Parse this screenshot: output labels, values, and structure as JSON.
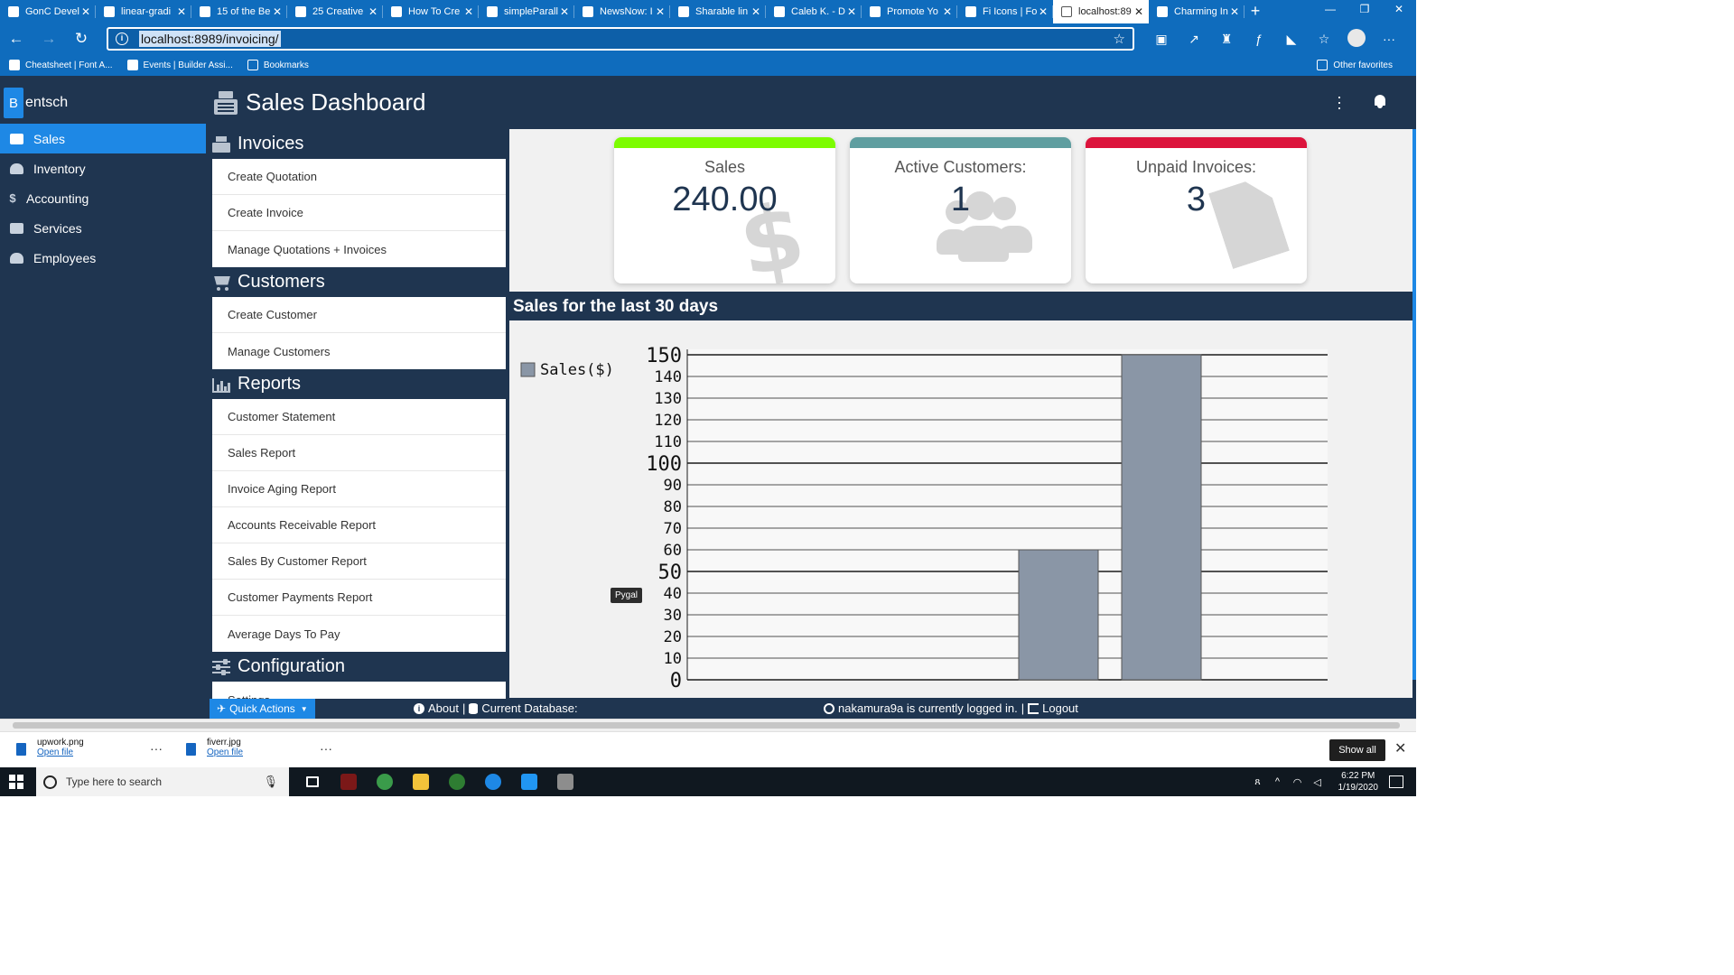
{
  "browser": {
    "tabs": [
      {
        "title": "GonC Devel",
        "icon": "page-icon",
        "active": false
      },
      {
        "title": "linear-gradi",
        "icon": "github-icon",
        "active": false
      },
      {
        "title": "15 of the Be",
        "icon": "site-icon",
        "active": false
      },
      {
        "title": "25 Creative",
        "icon": "se-icon",
        "active": false
      },
      {
        "title": "How To Cre",
        "icon": "site-icon",
        "active": false
      },
      {
        "title": "simpleParall",
        "icon": "site-icon",
        "active": false
      },
      {
        "title": "NewsNow: I",
        "icon": "news-icon",
        "active": false
      },
      {
        "title": "Sharable lin",
        "icon": "fiverr-icon",
        "active": false
      },
      {
        "title": "Caleb K. - D",
        "icon": "upwork-icon",
        "active": false
      },
      {
        "title": "Promote Yo",
        "icon": "fiverr-icon",
        "active": false
      },
      {
        "title": "Fi Icons | Fo",
        "icon": "flag-icon",
        "active": false
      },
      {
        "title": "localhost:89",
        "icon": "page-icon",
        "active": true
      },
      {
        "title": "Charming In",
        "icon": "page-icon",
        "active": false
      }
    ],
    "new_tab": "+",
    "window_controls": [
      "—",
      "❐",
      "✕"
    ],
    "url": "localhost:8989/invoicing/",
    "favorites": [
      {
        "label": "Cheatsheet | Font A...",
        "icon": "flag-icon"
      },
      {
        "label": "Events | Builder Assi...",
        "icon": "car-icon"
      },
      {
        "label": "Bookmarks",
        "icon": "folder-icon"
      }
    ],
    "other_favorites": "Other favorites"
  },
  "app": {
    "brand_letter": "B",
    "brand_rest": "entsch",
    "page_title": "Sales Dashboard",
    "sidebar": [
      {
        "label": "Sales",
        "icon": "register-icon",
        "active": true
      },
      {
        "label": "Inventory",
        "icon": "inventory-icon",
        "active": false
      },
      {
        "label": "Accounting",
        "icon": "dollar-icon",
        "active": false
      },
      {
        "label": "Services",
        "icon": "services-icon",
        "active": false
      },
      {
        "label": "Employees",
        "icon": "users-icon",
        "active": false
      }
    ],
    "menu": {
      "invoices": {
        "title": "Invoices",
        "items": [
          "Create Quotation",
          "Create Invoice",
          "Manage Quotations + Invoices"
        ]
      },
      "customers": {
        "title": "Customers",
        "items": [
          "Create Customer",
          "Manage Customers"
        ]
      },
      "reports": {
        "title": "Reports",
        "items": [
          "Customer Statement",
          "Sales Report",
          "Invoice Aging Report",
          "Accounts Receivable Report",
          "Sales By Customer Report",
          "Customer Payments Report",
          "Average Days To Pay"
        ]
      },
      "configuration": {
        "title": "Configuration",
        "items": [
          "Settings"
        ]
      }
    },
    "cards": [
      {
        "label": "Sales",
        "value": "240.00",
        "color": "#7cfc00",
        "icon": "dollar-icon"
      },
      {
        "label": "Active Customers:",
        "value": "1",
        "color": "#5f9ea0",
        "icon": "users-icon"
      },
      {
        "label": "Unpaid Invoices:",
        "value": "3",
        "color": "#dc143c",
        "icon": "file-icon"
      }
    ],
    "chart_title": "Sales for the last 30 days",
    "tooltip": "Pygal",
    "footer": {
      "quick_actions": "Quick Actions",
      "about": "About",
      "separator": "|",
      "current_database": "Current Database:",
      "logged_in": "nakamura9a is currently logged in.",
      "logout": "Logout"
    }
  },
  "chart_data": {
    "type": "bar",
    "series": [
      {
        "name": "Sales($)",
        "values": [
          0,
          0,
          0,
          60,
          150,
          0
        ]
      }
    ],
    "ylim": [
      0,
      150
    ],
    "yticks": [
      0,
      10,
      20,
      30,
      40,
      50,
      60,
      70,
      80,
      90,
      100,
      110,
      120,
      130,
      140,
      150
    ],
    "major_ticks": [
      0,
      50,
      100,
      150
    ],
    "legend": "top-left",
    "grid": true,
    "bar_color": "#8a96a6"
  },
  "downloads": [
    {
      "name": "upwork.png",
      "action": "Open file"
    },
    {
      "name": "fiverr.jpg",
      "action": "Open file"
    }
  ],
  "show_all": "Show all",
  "taskbar": {
    "search_placeholder": "Type here to search",
    "time": "6:22 PM",
    "date": "1/19/2020"
  }
}
